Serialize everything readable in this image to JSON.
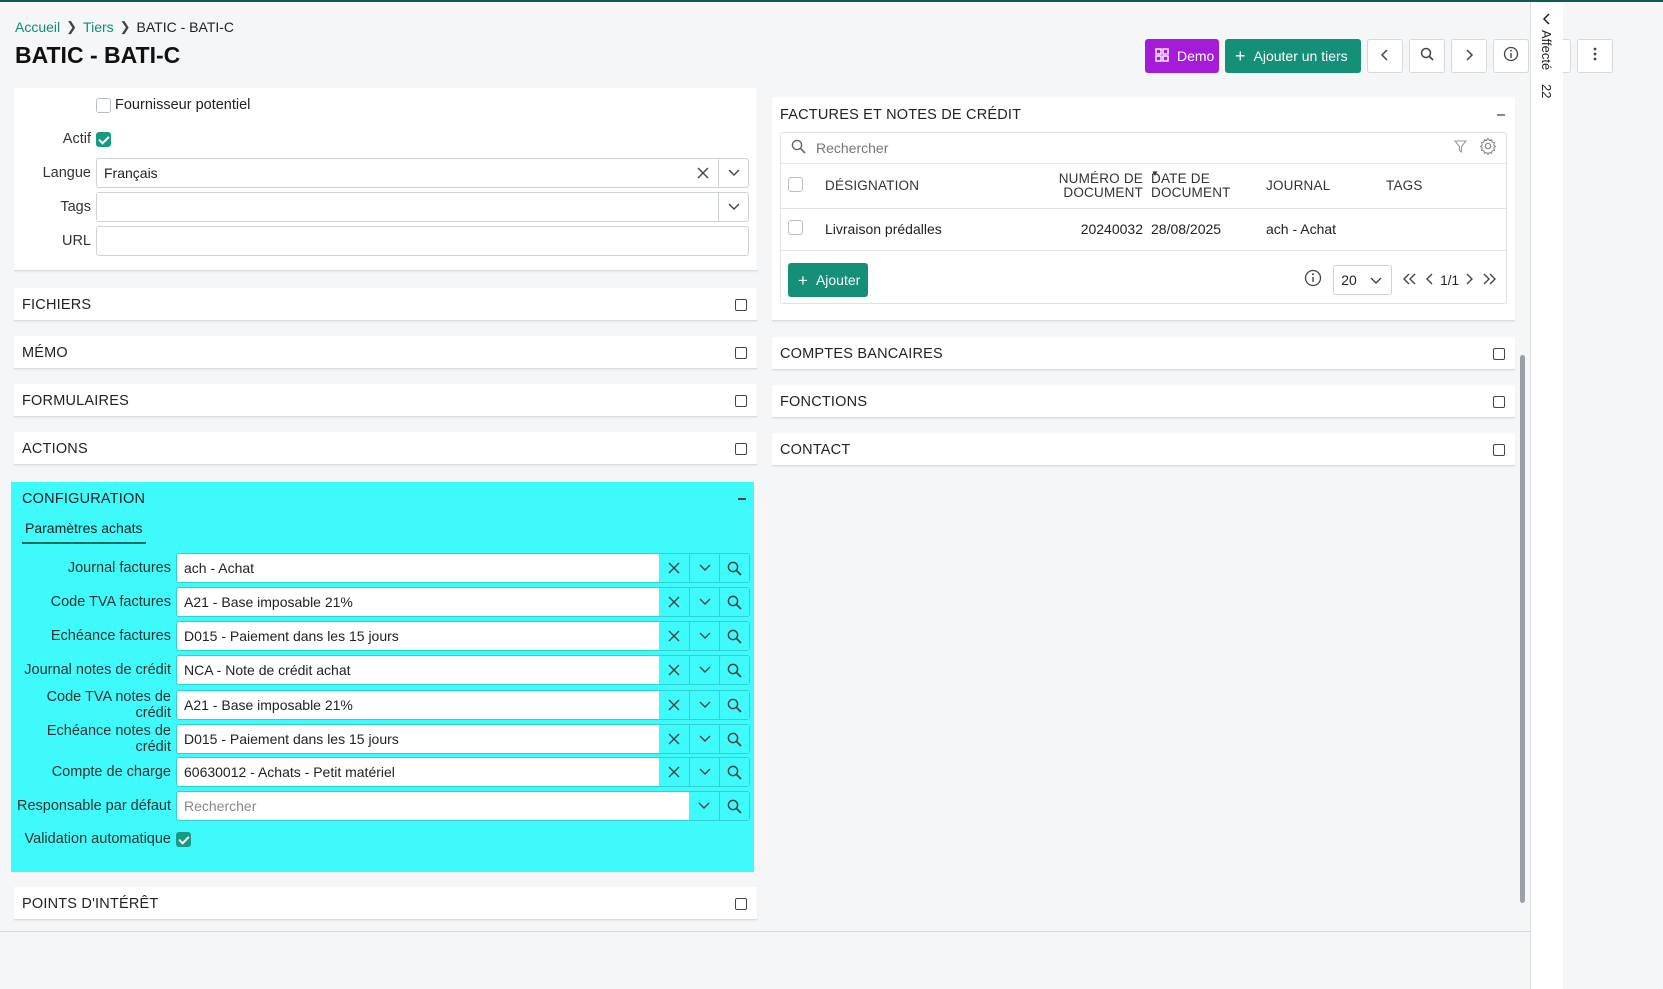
{
  "breadcrumb": {
    "home": "Accueil",
    "tiers": "Tiers",
    "current": "BATIC - BATI-C"
  },
  "page_title": "BATIC - BATI-C",
  "toolbar": {
    "demo_label": "Demo",
    "add_label": "Ajouter un tiers"
  },
  "general": {
    "fournisseur_label": "Fournisseur potentiel",
    "actif_label": "Actif",
    "actif_checked": true,
    "langue_label": "Langue",
    "langue_value": "Français",
    "tags_label": "Tags",
    "tags_value": "",
    "url_label": "URL",
    "url_value": ""
  },
  "sections_left": {
    "fichiers": "FICHIERS",
    "memo": "MÉMO",
    "formulaires": "FORMULAIRES",
    "actions": "ACTIONS",
    "points": "POINTS D'INTÉRÊT"
  },
  "configuration": {
    "title": "CONFIGURATION",
    "tab_label": "Paramètres achats",
    "fields": [
      {
        "label": "Journal factures",
        "value": "ach - Achat"
      },
      {
        "label": "Code TVA factures",
        "value": "A21 - Base imposable 21%"
      },
      {
        "label": "Echéance factures",
        "value": "D015 - Paiement dans les 15 jours"
      },
      {
        "label": "Journal notes de crédit",
        "value": "NCA - Note de crédit achat"
      },
      {
        "label": "Code TVA notes de crédit",
        "value": "A21 - Base imposable 21%"
      },
      {
        "label": "Echéance notes de crédit",
        "value": "D015 - Paiement dans les 15 jours"
      },
      {
        "label": "Compte de charge",
        "value": "60630012 - Achats - Petit matériel"
      }
    ],
    "responsable_label": "Responsable par défaut",
    "responsable_placeholder": "Rechercher",
    "validation_label": "Validation automatique",
    "validation_checked": true
  },
  "factures": {
    "title": "FACTURES ET NOTES DE CRÉDIT",
    "search_placeholder": "Rechercher",
    "columns": {
      "designation": "DÉSIGNATION",
      "numero_line1": "NUMÉRO DE",
      "numero_line2": "DOCUMENT",
      "date_line1": "DATE DE",
      "date_line2": "DOCUMENT",
      "journal": "JOURNAL",
      "tags": "TAGS"
    },
    "rows": [
      {
        "designation": "Livraison prédalles",
        "numero": "20240032",
        "date": "28/08/2025",
        "journal": "ach - Achat",
        "tags": ""
      }
    ],
    "add_label": "Ajouter",
    "page_size": "20",
    "pagination": "1/1"
  },
  "sections_right": {
    "comptes": "COMPTES BANCAIRES",
    "fonctions": "FONCTIONS",
    "contact": "CONTACT"
  },
  "rail": {
    "label": "Affecté",
    "count": "22"
  },
  "colors": {
    "accent": "#148f78",
    "demo": "#a61bd8",
    "highlight": "#3ffafa"
  }
}
